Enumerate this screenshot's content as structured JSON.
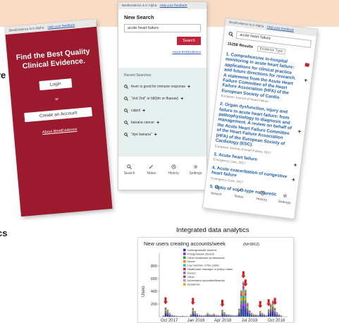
{
  "left_labels": {
    "line1": "re",
    "line2": "cs"
  },
  "phone_login": {
    "status_text": "BestEvidence is in Alpha.",
    "status_link": "Help your feedback",
    "title_line1": "Find the Best Quality",
    "title_line2": "Clinical Evidence.",
    "login_label": "Login",
    "or_text": "or",
    "create_label": "Create an Account",
    "about_link": "About BestEvidence"
  },
  "phone_search": {
    "status_text": "BestEvidence is in Alpha.",
    "status_link": "Help your feedback",
    "heading": "New Search",
    "query_value": "acute heart failure",
    "search_button": "Search",
    "about_link": "About BestEvidence",
    "recent_heading": "Recent Searches",
    "recent": [
      "fever is good for immune response",
      "\"ckd 2nd\" or ldl(bhr or fbaoaw)",
      "calpol",
      "banana cancer",
      "\"dye banana\""
    ],
    "nav": [
      "Search",
      "Notes",
      "History",
      "Settings"
    ]
  },
  "phone_results": {
    "status_text": "BestEvidence is in Alpha.",
    "status_link": "Help your feedback",
    "query_value": "acute heart failure",
    "results_count": "15258 Results",
    "evidence_type": "Evidence Type",
    "results": [
      {
        "title": "1. Comprehensive in-hospital monitoring in acute heart failure: applications for clinical practice and future directions for research. A statement from the Acute Heart Failure Committee of the Heart Failure Association (HFA) of the European Society of Cardio",
        "source": "European Journal of Heart Failure"
      },
      {
        "title": "2. Organ dysfunction, injury and failure in acute heart failure: from pathophysiology to diagnosis and management. A review on behalf of the Acute Heart Failure Committee of the Heart Failure Association (HFA) of the European Society of Cardiology (ESC).",
        "source": "European Journal of Heart Failure, 2017"
      },
      {
        "title": "3. Acute heart failure",
        "source": "Emergency Care, 2017"
      },
      {
        "title": "4. Acute exacerbation of congestive heart failure",
        "source": "Emergency Care, 2017"
      },
      {
        "title": "5. Ratio of sol-B-type natriuretic",
        "source": ""
      }
    ],
    "nav": [
      "Search",
      "Notes",
      "History",
      "Settings"
    ]
  },
  "chart_caption": "Integrated data analytics",
  "chart_data": {
    "type": "bar",
    "title": "New users creating accounts/week",
    "subtitle": "(N=3812)",
    "ylabel": "Users",
    "ylim": [
      0,
      1000
    ],
    "yticks": [
      200,
      400,
      600,
      800
    ],
    "xticklabels": [
      "Oct 2017",
      "Jan 2018",
      "Apr 2018",
      "Jul 2018",
      "Oct 2018"
    ],
    "legend": [
      "Undergraduate student",
      "Postgraduate student",
      "Other healthcare professional",
      "Nurse",
      "Lay member of the public",
      "Healthcare manager or policy maker",
      "Doctor",
      "Other",
      "Information specialist/librarian",
      "Academic"
    ],
    "colors": [
      "#1f3a93",
      "#8a2be2",
      "#2ca02c",
      "#ff7f0e",
      "#17becf",
      "#d62728",
      "#9467bd",
      "#8c564b",
      "#e377c2",
      "#bcbd22"
    ],
    "weeks": [
      "2017-10-02",
      "2017-10-09",
      "2017-10-16",
      "2017-10-23",
      "2017-10-30",
      "2017-11-06",
      "2017-11-13",
      "2017-11-20",
      "2017-11-27",
      "2017-12-04",
      "2017-12-11",
      "2017-12-18",
      "2017-12-25",
      "2018-01-01",
      "2018-01-08",
      "2018-01-15",
      "2018-01-22",
      "2018-01-29",
      "2018-02-05",
      "2018-02-12",
      "2018-02-19",
      "2018-02-26",
      "2018-03-05",
      "2018-03-12",
      "2018-03-19",
      "2018-03-26",
      "2018-04-02",
      "2018-04-09",
      "2018-04-16",
      "2018-04-23",
      "2018-04-30",
      "2018-05-07",
      "2018-05-14",
      "2018-05-21",
      "2018-05-28",
      "2018-06-04",
      "2018-06-11",
      "2018-06-18",
      "2018-06-25",
      "2018-07-02",
      "2018-07-09",
      "2018-07-16",
      "2018-07-23",
      "2018-07-30",
      "2018-08-06",
      "2018-08-13",
      "2018-08-20",
      "2018-08-27",
      "2018-09-03",
      "2018-09-10",
      "2018-09-17",
      "2018-09-24",
      "2018-10-01",
      "2018-10-08",
      "2018-10-15",
      "2018-10-22",
      "2018-10-29"
    ],
    "values": [
      20,
      150,
      110,
      60,
      30,
      20,
      15,
      10,
      10,
      15,
      10,
      8,
      5,
      40,
      140,
      90,
      50,
      30,
      25,
      20,
      30,
      60,
      40,
      35,
      50,
      30,
      25,
      20,
      110,
      70,
      40,
      35,
      30,
      25,
      20,
      30,
      130,
      420,
      560,
      430,
      220,
      100,
      60,
      40,
      35,
      30,
      90,
      60,
      40,
      25,
      120,
      200,
      260,
      140,
      70,
      40,
      20
    ],
    "annotations": [
      "2017-10-09",
      "2018-01-08",
      "2018-04-16",
      "2018-06-25",
      "2018-07-02",
      "2018-08-20",
      "2018-09-17",
      "2018-10-08"
    ]
  }
}
